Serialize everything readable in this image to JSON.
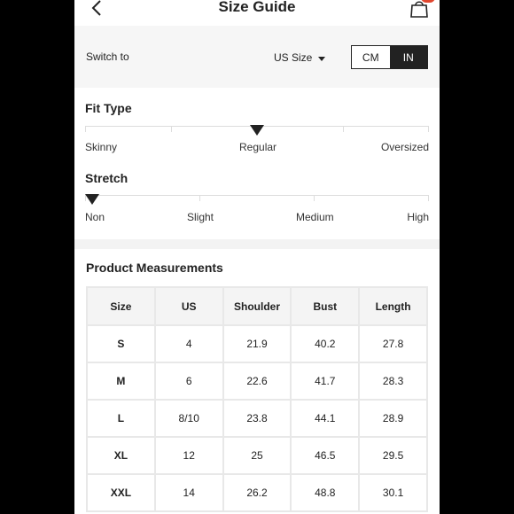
{
  "header": {
    "title": "Size Guide",
    "back_icon": "chevron-left-icon",
    "bag_icon": "shopping-bag-icon",
    "badge_color": "#e0462e"
  },
  "switch_row": {
    "label": "Switch to",
    "size_select": "US Size",
    "units": [
      {
        "label": "CM",
        "selected": false
      },
      {
        "label": "IN",
        "selected": true
      }
    ]
  },
  "fit_type": {
    "title": "Fit Type",
    "labels": [
      "Skinny",
      "Regular",
      "Oversized"
    ],
    "selected": "Regular"
  },
  "stretch": {
    "title": "Stretch",
    "labels": [
      "Non",
      "Slight",
      "Medium",
      "High"
    ],
    "selected": "Non"
  },
  "measurements": {
    "title": "Product Measurements",
    "columns": [
      "Size",
      "US",
      "Shoulder",
      "Bust",
      "Length"
    ],
    "rows": [
      [
        "S",
        "4",
        "21.9",
        "40.2",
        "27.8"
      ],
      [
        "M",
        "6",
        "22.6",
        "41.7",
        "28.3"
      ],
      [
        "L",
        "8/10",
        "23.8",
        "44.1",
        "28.9"
      ],
      [
        "XL",
        "12",
        "25",
        "46.5",
        "29.5"
      ],
      [
        "XXL",
        "14",
        "26.2",
        "48.8",
        "30.1"
      ]
    ]
  }
}
